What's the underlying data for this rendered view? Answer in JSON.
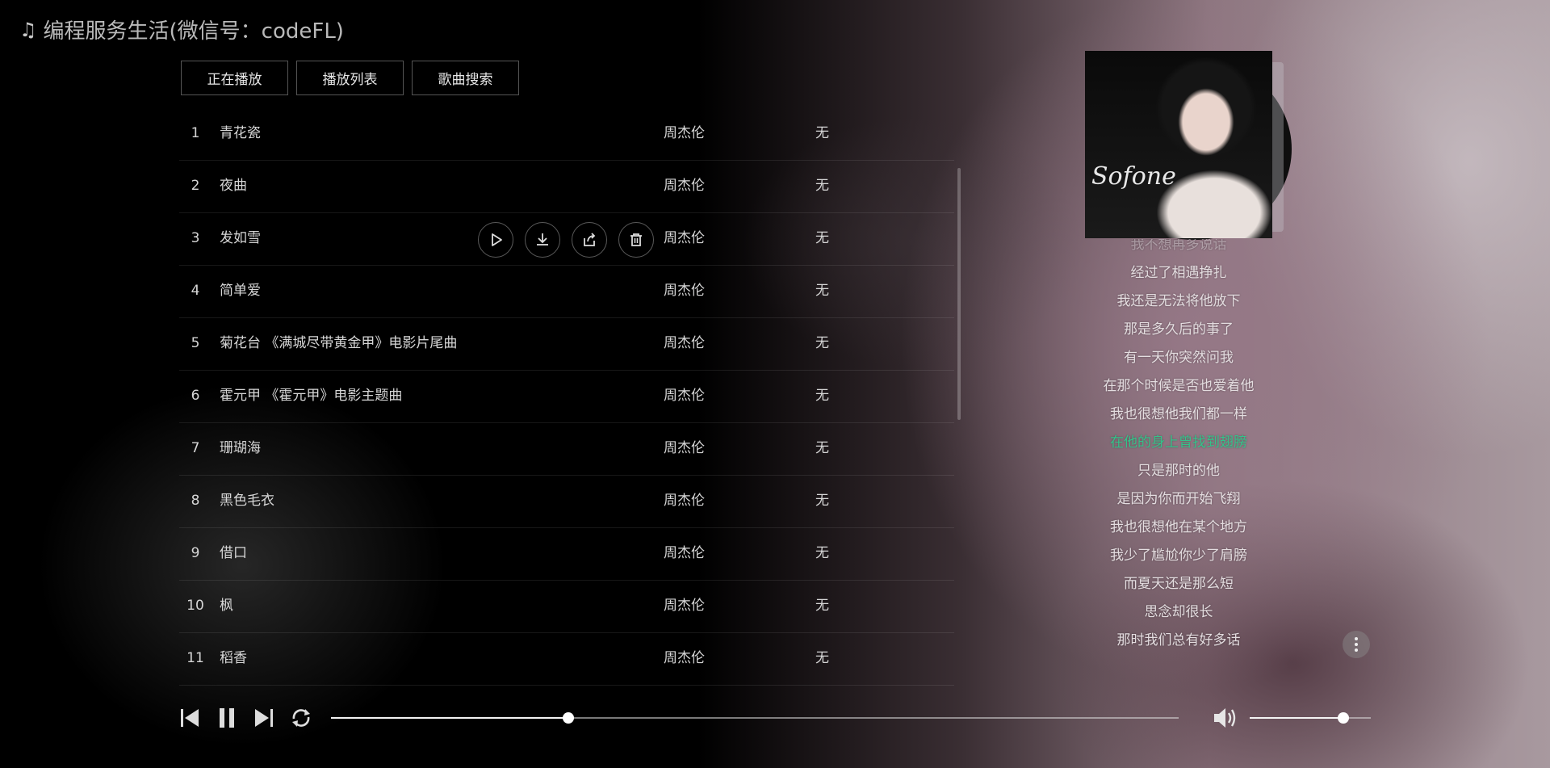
{
  "header": {
    "app_title": "编程服务生活(微信号：codeFL)",
    "note_icon": "music-note-icon"
  },
  "tabs": [
    {
      "label": "正在播放"
    },
    {
      "label": "播放列表"
    },
    {
      "label": "歌曲搜索"
    }
  ],
  "songs": [
    {
      "index": "1",
      "title": "青花瓷",
      "artist": "周杰伦",
      "album": "无"
    },
    {
      "index": "2",
      "title": "夜曲",
      "artist": "周杰伦",
      "album": "无"
    },
    {
      "index": "3",
      "title": "发如雪",
      "artist": "周杰伦",
      "album": "无"
    },
    {
      "index": "4",
      "title": "简单爱",
      "artist": "周杰伦",
      "album": "无"
    },
    {
      "index": "5",
      "title": "菊花台 《满城尽带黄金甲》电影片尾曲",
      "artist": "周杰伦",
      "album": "无"
    },
    {
      "index": "6",
      "title": "霍元甲 《霍元甲》电影主题曲",
      "artist": "周杰伦",
      "album": "无"
    },
    {
      "index": "7",
      "title": "珊瑚海",
      "artist": "周杰伦",
      "album": "无"
    },
    {
      "index": "8",
      "title": "黑色毛衣",
      "artist": "周杰伦",
      "album": "无"
    },
    {
      "index": "9",
      "title": "借口",
      "artist": "周杰伦",
      "album": "无"
    },
    {
      "index": "10",
      "title": "枫",
      "artist": "周杰伦",
      "album": "无"
    },
    {
      "index": "11",
      "title": "稻香",
      "artist": "周杰伦",
      "album": "无"
    }
  ],
  "hovered_row_index": 2,
  "row_actions": [
    "play-icon",
    "download-icon",
    "share-icon",
    "delete-icon"
  ],
  "album_cover": {
    "signature": "Sofone"
  },
  "lyrics": {
    "lines": [
      "我不想再多说话",
      "经过了相遇挣扎",
      "我还是无法将他放下",
      "那是多久后的事了",
      "有一天你突然问我",
      "在那个时候是否也爱着他",
      "我也很想他我们都一样",
      "在他的身上曾找到翅膀",
      "只是那时的他",
      "是因为你而开始飞翔",
      "我也很想他在某个地方",
      "我少了尴尬你少了肩膀",
      "而夏天还是那么短",
      "思念却很长",
      "那时我们总有好多话"
    ],
    "active_index": 7,
    "active_color": "#35c28a"
  },
  "player": {
    "progress_fraction": 0.28,
    "volume_fraction": 0.77,
    "controls": [
      "previous-icon",
      "pause-icon",
      "next-icon",
      "loop-icon"
    ],
    "volume_icon": "volume-icon"
  }
}
